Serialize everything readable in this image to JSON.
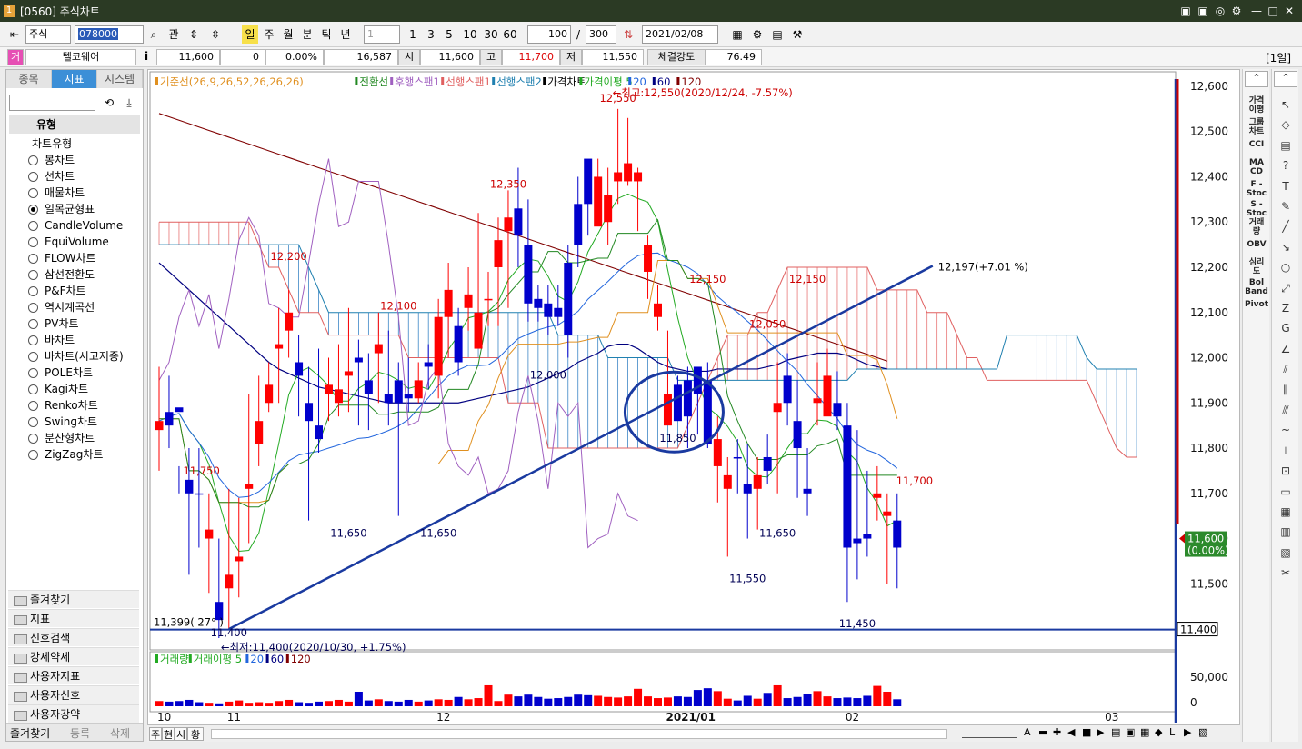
{
  "window": {
    "number": "1",
    "title": "[0560] 주식차트",
    "buttons": [
      "▣",
      "▣",
      "◎",
      "⚙",
      "—",
      "□",
      "✕"
    ]
  },
  "toolbar": {
    "market": "주식",
    "code": "078000",
    "kwan": "관",
    "periods": [
      "일",
      "주",
      "월",
      "분",
      "틱",
      "년"
    ],
    "minute_unit": "1",
    "intervals": [
      "1",
      "3",
      "5",
      "10",
      "30",
      "60"
    ],
    "count": "100",
    "slash": "/",
    "total": "300",
    "date": "2021/02/08",
    "days_label": "[1일]"
  },
  "quote": {
    "market_tag": "거",
    "name": "텔코웨어",
    "info": "i",
    "price": "11,600",
    "change": "0",
    "change_rate": "0.00%",
    "volume": "16,587",
    "open_label": "시",
    "open": "11,600",
    "high_label": "고",
    "high": "11,700",
    "low_label": "저",
    "low": "11,550",
    "strength_label": "체결강도",
    "strength": "76.49"
  },
  "left": {
    "tabs": [
      "종목",
      "지표",
      "시스템"
    ],
    "section": "유형",
    "group": "차트유형",
    "chart_types": [
      "봉차트",
      "선차트",
      "매물차트",
      "일목균형표",
      "CandleVolume",
      "EquiVolume",
      "FLOW차트",
      "삼선전환도",
      "P&F차트",
      "역시계곡선",
      "PV차트",
      "바차트",
      "바차트(시고저종)",
      "POLE차트",
      "Kagi차트",
      "Renko차트",
      "Swing차트",
      "분산형차트",
      "ZigZag차트"
    ],
    "selected": 3,
    "folders": [
      "즐겨찾기",
      "지표",
      "신호검색",
      "강세약세",
      "사용자지표",
      "사용자신호",
      "사용자강약"
    ],
    "bottom_tabs": [
      "즐겨찾기",
      "등록",
      "삭제"
    ]
  },
  "right_indicators": [
    "가격\n이평",
    "그룹\n차트",
    "CCI",
    "MA\nCD",
    "F -\nStoc",
    "S -\nStoc",
    "거래\n량",
    "OBV",
    "심리\n도",
    "Bol\nBand",
    "Pivot"
  ],
  "tools": [
    "↖",
    "◇",
    "▤",
    "?",
    "T",
    "✎",
    "╱",
    "↘",
    "○",
    "⤢",
    "Z",
    "G",
    "∠",
    "⫽",
    "⫼",
    "⫻",
    "~",
    "⊥",
    "⊡",
    "▭",
    "▦",
    "▥",
    "▧",
    "✂"
  ],
  "bottom": {
    "left_buttons": [
      "주",
      "현",
      "시",
      "황"
    ],
    "icons": [
      "A",
      "▬",
      "✚",
      "◀",
      "■",
      "▶",
      "▤",
      "▣",
      "▦",
      "◆",
      "L",
      "▶",
      "▧"
    ]
  },
  "colors": {
    "up": "#ff0000",
    "down": "#0000cc",
    "cloud_up": "#e87777",
    "cloud_down": "#3d86c6"
  },
  "chart_data": {
    "type": "candlestick",
    "price_axis": {
      "ticks": [
        "12,600",
        "12,500",
        "12,400",
        "12,300",
        "12,200",
        "12,100",
        "12,000",
        "11,900",
        "11,800",
        "11,700",
        "11,600",
        "11,500"
      ],
      "min": 11370,
      "max": 12620
    },
    "legend": [
      {
        "text": "기준선(26,9,26,52,26,26,26)",
        "color": "#e09020"
      },
      {
        "text": "전환선",
        "color": "#228822"
      },
      {
        "text": "후행스팬1",
        "color": "#a060c0"
      },
      {
        "text": "선행스팬1",
        "color": "#e06060"
      },
      {
        "text": "선행스팬2",
        "color": "#2080b0"
      },
      {
        "text": "가격차트",
        "color": "#000000"
      },
      {
        "text": "가격이평 5",
        "color": "#22aa22"
      },
      {
        "text": "20",
        "color": "#2266dd"
      },
      {
        "text": "60",
        "color": "#000080"
      },
      {
        "text": "120",
        "color": "#800000"
      }
    ],
    "x_labels": [
      {
        "text": "10",
        "i": 0
      },
      {
        "text": "11",
        "i": 7
      },
      {
        "text": "12",
        "i": 28
      },
      {
        "text": "2021/01",
        "i": 51
      },
      {
        "text": "02",
        "i": 69
      },
      {
        "text": "03",
        "i": 95
      }
    ],
    "candles": [
      [
        11840,
        11860,
        11750,
        11980
      ],
      [
        11850,
        11880,
        11800,
        11960
      ],
      [
        11880,
        11890,
        11760,
        11700
      ],
      [
        11700,
        11730,
        11520,
        11800
      ],
      [
        11700,
        11700,
        11580,
        11800
      ],
      [
        11600,
        11620,
        11480,
        11700
      ],
      [
        11420,
        11460,
        11380,
        11600
      ],
      [
        11490,
        11520,
        11400,
        11710
      ],
      [
        11550,
        11560,
        11470,
        11690
      ],
      [
        11720,
        11710,
        11590,
        11920
      ],
      [
        11860,
        11810,
        11760,
        11960
      ],
      [
        11900,
        11940,
        11880,
        11990
      ],
      [
        12020,
        12030,
        11900,
        12110
      ],
      [
        12060,
        12100,
        12000,
        12150
      ],
      [
        11990,
        11960,
        11870,
        12050
      ],
      [
        11900,
        11860,
        11640,
        11980
      ],
      [
        11820,
        11850,
        11790,
        12020
      ],
      [
        11940,
        11920,
        11860,
        12000
      ],
      [
        11900,
        11930,
        11870,
        12030
      ],
      [
        11970,
        11960,
        11880,
        12110
      ],
      [
        11990,
        12000,
        11850,
        12040
      ],
      [
        11950,
        11920,
        11840,
        12010
      ],
      [
        12010,
        12030,
        11900,
        12100
      ],
      [
        11920,
        11900,
        11850,
        12060
      ],
      [
        11950,
        11900,
        11650,
        11990
      ],
      [
        11920,
        11910,
        11880,
        12000
      ],
      [
        11910,
        11950,
        11900,
        11990
      ],
      [
        11980,
        11990,
        11930,
        12030
      ],
      [
        11960,
        12090,
        11910,
        12130
      ],
      [
        12090,
        12150,
        12000,
        12210
      ],
      [
        11990,
        12070,
        11960,
        12110
      ],
      [
        12110,
        12140,
        12060,
        12200
      ],
      [
        12100,
        12020,
        12050,
        12320
      ],
      [
        12130,
        12130,
        12070,
        12190
      ],
      [
        12200,
        12260,
        12070,
        12310
      ],
      [
        12280,
        12310,
        12110,
        12370
      ],
      [
        12330,
        12270,
        12200,
        12420
      ],
      [
        12250,
        12120,
        12080,
        12350
      ],
      [
        12130,
        12110,
        12080,
        12160
      ],
      [
        12120,
        12090,
        12050,
        12160
      ],
      [
        12110,
        12090,
        12070,
        12160
      ],
      [
        12050,
        12210,
        12000,
        12250
      ],
      [
        12250,
        12340,
        12200,
        12400
      ],
      [
        12340,
        12440,
        12270,
        12430
      ],
      [
        12400,
        12290,
        12300,
        12440
      ],
      [
        12360,
        12300,
        12250,
        12420
      ],
      [
        12410,
        12390,
        12340,
        12550
      ],
      [
        12430,
        12390,
        12380,
        12530
      ],
      [
        12410,
        12390,
        12280,
        12420
      ],
      [
        12190,
        12250,
        12130,
        12270
      ],
      [
        12120,
        12090,
        12060,
        12160
      ],
      [
        11920,
        11850,
        11880,
        12060
      ],
      [
        11940,
        11860,
        11880,
        11960
      ],
      [
        11870,
        11950,
        11800,
        11980
      ],
      [
        11920,
        11980,
        11830,
        11960
      ],
      [
        11950,
        11810,
        11800,
        11990
      ],
      [
        11820,
        11760,
        11680,
        11870
      ],
      [
        11710,
        11740,
        11560,
        11780
      ],
      [
        11780,
        11780,
        11700,
        11820
      ],
      [
        11720,
        11700,
        11600,
        11810
      ],
      [
        11740,
        11710,
        11620,
        11780
      ],
      [
        11780,
        11750,
        11720,
        11830
      ],
      [
        11900,
        11880,
        11700,
        11990
      ],
      [
        11900,
        11960,
        11850,
        12010
      ],
      [
        11800,
        11860,
        11690,
        11950
      ],
      [
        11700,
        11710,
        11650,
        11800
      ],
      [
        11910,
        11900,
        11850,
        11990
      ],
      [
        11960,
        11870,
        11880,
        12020
      ],
      [
        11870,
        11900,
        11840,
        11970
      ],
      [
        11850,
        11580,
        11460,
        11900
      ],
      [
        11590,
        11600,
        11510,
        11840
      ],
      [
        11600,
        11610,
        11560,
        11750
      ],
      [
        11690,
        11700,
        11640,
        11760
      ],
      [
        11660,
        11650,
        11500,
        11700
      ],
      [
        11580,
        11640,
        11490,
        11700
      ]
    ],
    "up_colored": [
      0,
      5,
      7,
      8,
      9,
      10,
      11,
      12,
      13,
      17,
      18,
      19,
      22,
      26,
      28,
      29,
      31,
      32,
      33,
      34,
      35,
      44,
      45,
      46,
      47,
      48,
      49,
      50,
      51,
      56,
      57,
      60,
      62,
      66,
      67,
      72,
      73
    ],
    "volume_axis": {
      "ticks": [
        "50,000",
        "0"
      ],
      "max": 75000
    },
    "volume": [
      9000,
      8000,
      9000,
      11000,
      7000,
      6000,
      5000,
      8000,
      10000,
      6000,
      7000,
      6000,
      9000,
      11000,
      7000,
      6000,
      8000,
      9000,
      11000,
      8000,
      25000,
      10000,
      12000,
      9000,
      8000,
      11000,
      8000,
      10000,
      12000,
      11000,
      16000,
      12000,
      14000,
      36000,
      9000,
      20000,
      17000,
      20000,
      16000,
      13000,
      14000,
      16000,
      20000,
      19000,
      18000,
      16000,
      15000,
      17000,
      30000,
      17000,
      14000,
      15000,
      17000,
      16000,
      28000,
      31000,
      26000,
      13000,
      10000,
      18000,
      13000,
      23000,
      36000,
      14000,
      16000,
      21000,
      26000,
      17000,
      14000,
      15000,
      14000,
      18000,
      35000,
      25000,
      12000
    ],
    "annotations": [
      {
        "text": "12,550",
        "i": 46,
        "p": 12550,
        "pos": "above",
        "color": "#cc0000"
      },
      {
        "text": "12,350",
        "i": 35,
        "p": 12360,
        "pos": "above",
        "color": "#cc0000"
      },
      {
        "text": "12,200",
        "i": 13,
        "p": 12200,
        "pos": "above",
        "color": "#cc0000"
      },
      {
        "text": "12,100",
        "i": 24,
        "p": 12090,
        "pos": "above",
        "color": "#cc0000"
      },
      {
        "text": "12,150",
        "i": 55,
        "p": 12150,
        "pos": "above",
        "color": "#cc0000"
      },
      {
        "text": "12,050",
        "i": 61,
        "p": 12050,
        "pos": "above",
        "color": "#cc0000"
      },
      {
        "text": "12,150",
        "i": 65,
        "p": 12150,
        "pos": "above",
        "color": "#cc0000"
      },
      {
        "text": "11,750",
        "i": 7,
        "p": 11750,
        "pos": "left",
        "color": "#cc0000"
      },
      {
        "text": "11,700",
        "i": 73,
        "p": 11700,
        "pos": "right",
        "color": "#cc0000"
      },
      {
        "text": "12,000",
        "i": 39,
        "p": 11990,
        "pos": "below",
        "color": "#000055"
      },
      {
        "text": "11,850",
        "i": 52,
        "p": 11850,
        "pos": "below",
        "color": "#000055"
      },
      {
        "text": "11,650",
        "i": 19,
        "p": 11640,
        "pos": "below",
        "color": "#000055"
      },
      {
        "text": "11,650",
        "i": 28,
        "p": 11640,
        "pos": "below",
        "color": "#000055"
      },
      {
        "text": "11,650",
        "i": 62,
        "p": 11640,
        "pos": "below",
        "color": "#000055"
      },
      {
        "text": "11,550",
        "i": 59,
        "p": 11540,
        "pos": "below",
        "color": "#000055"
      },
      {
        "text": "11,450",
        "i": 70,
        "p": 11440,
        "pos": "below",
        "color": "#000055"
      },
      {
        "text": "11,400",
        "i": 7,
        "p": 11420,
        "pos": "below",
        "color": "#000055"
      }
    ],
    "highest_note": "←최고:12,550(2020/12/24, -7.57%)",
    "lowest_note": "←최저:11,400(2020/10/30, +1.75%)",
    "trendline": {
      "from": {
        "i": 7,
        "p": 11400
      },
      "to": {
        "i": 73,
        "p": 12197
      },
      "label": "12,197(+7.01 %)"
    },
    "hline": {
      "p": 11399,
      "label": "11,399( 27° )",
      "axis_tag": "11,400"
    },
    "current_tag": {
      "price": "11,600",
      "rate": "(0.00%)"
    },
    "volume_legend": [
      "거래량",
      "거래이평 5",
      "20",
      "60",
      "120"
    ]
  }
}
